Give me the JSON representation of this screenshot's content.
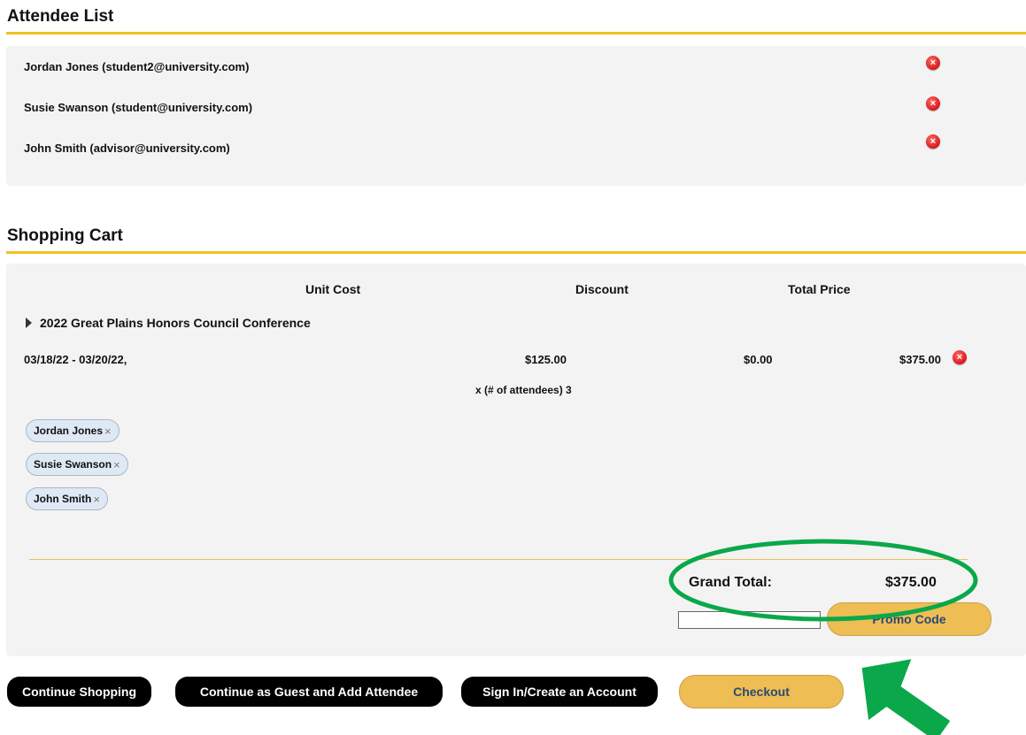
{
  "attendee_list": {
    "title": "Attendee List",
    "attendees": [
      {
        "label": "Jordan Jones (student2@university.com)",
        "remove_icon": "remove-circle-icon"
      },
      {
        "label": "Susie Swanson (student@university.com)",
        "remove_icon": "remove-circle-icon"
      },
      {
        "label": "John Smith (advisor@university.com)",
        "remove_icon": "remove-circle-icon"
      }
    ]
  },
  "cart": {
    "title": "Shopping Cart",
    "headers": {
      "unit_cost": "Unit Cost",
      "discount": "Discount",
      "total_price": "Total Price"
    },
    "item": {
      "name": "2022 Great Plains Honors Council Conference",
      "dates": "03/18/22 - 03/20/22,",
      "unit_cost": "$125.00",
      "discount": "$0.00",
      "total_price": "$375.00",
      "quantity_text": "x (# of attendees) 3",
      "attendee_chips": [
        "Jordan Jones",
        "Susie Swanson",
        "John Smith"
      ]
    },
    "grand_total_label": "Grand Total:",
    "grand_total_value": "$375.00",
    "promo": {
      "input_value": "",
      "button_label": "Promo Code"
    }
  },
  "actions": {
    "continue_shopping": "Continue Shopping",
    "continue_guest": "Continue as Guest and Add Attendee",
    "sign_in": "Sign In/Create an Account",
    "checkout": "Checkout"
  },
  "colors": {
    "accent_rule": "#f0c020",
    "gold_button": "#eebd54",
    "annotation_green": "#0aa84a",
    "remove_red": "#d81818"
  }
}
